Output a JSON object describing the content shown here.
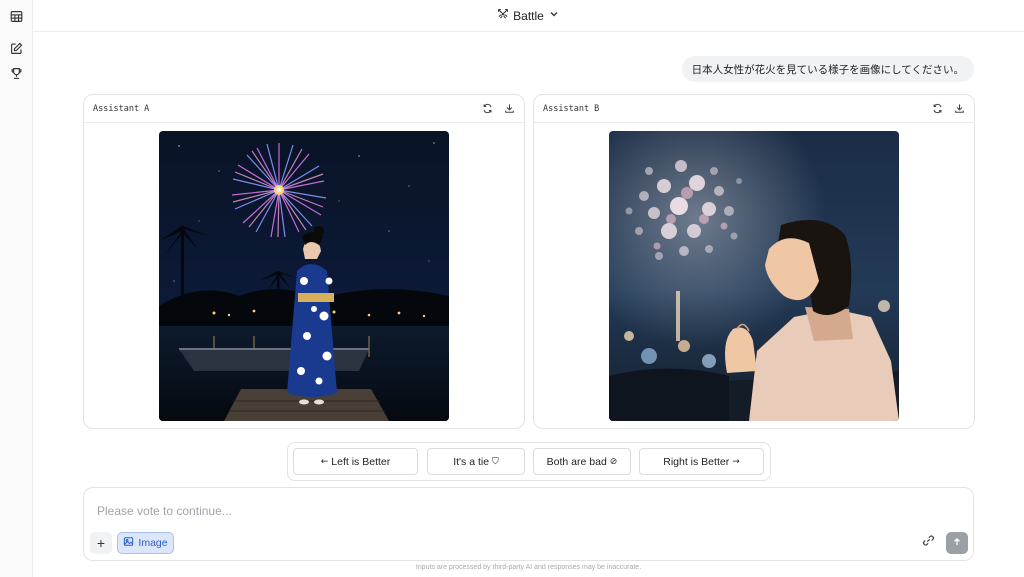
{
  "header": {
    "mode_label": "Battle",
    "mode_icon": "swords-icon"
  },
  "sidebar": {
    "items": [
      {
        "name": "table-icon"
      },
      {
        "name": "edit-icon"
      },
      {
        "name": "trophy-icon"
      }
    ]
  },
  "conversation": {
    "user_prompt": "日本人女性が花火を見ている様子を画像にしてください。"
  },
  "panels": [
    {
      "title": "Assistant A",
      "image": "kimono woman on dock watching firework"
    },
    {
      "title": "Assistant B",
      "image": "woman looking up at fireworks bokeh"
    }
  ],
  "vote": {
    "left_label": "Left is Better",
    "left_glyph": "←",
    "tie_label": "It's a tie",
    "tie_glyph": "⛉",
    "bad_label": "Both are bad",
    "bad_glyph": "⊘",
    "right_label": "Right is Better",
    "right_glyph": "→"
  },
  "composer": {
    "placeholder": "Please vote to continue...",
    "plus_label": "+",
    "image_label": "Image"
  },
  "footer": {
    "disclaimer": "Inputs are processed by third-party AI and responses may be inaccurate."
  },
  "colors": {
    "accent_blue": "#2f5fc4",
    "image_btn_bg": "#dbe6fb",
    "send_btn_bg": "#9aa0a6"
  }
}
